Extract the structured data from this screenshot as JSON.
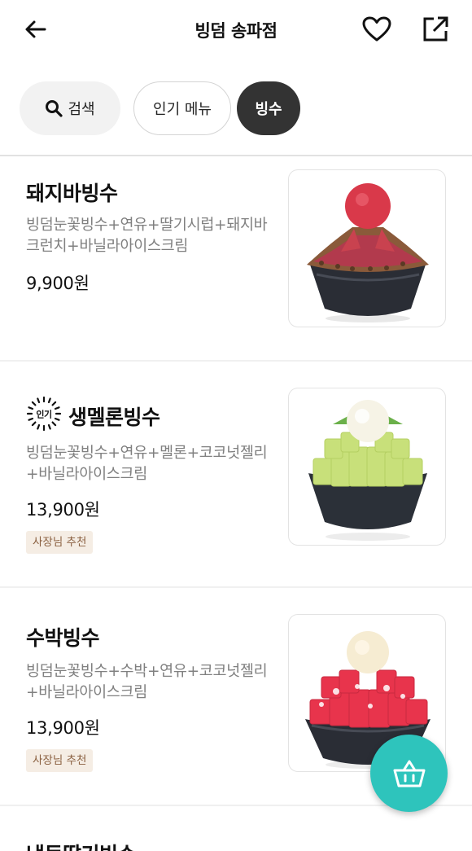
{
  "header": {
    "title": "빙덤 송파점",
    "icons": [
      "back-arrow-icon",
      "heart-icon",
      "share-icon"
    ]
  },
  "chips": {
    "search_label": "검색",
    "popular_label": "인기 메뉴",
    "bingsu_label": "빙수"
  },
  "menu_items": [
    {
      "name": "돼지바빙수",
      "description": "빙덤눈꽃빙수+연유+딸기시럽+돼지바크런치+바닐라아이스크림",
      "price": "9,900원"
    },
    {
      "popular_tag": "인기",
      "name": "생멜론빙수",
      "description": "빙덤눈꽃빙수+연유+멜론+코코넛젤리+바닐라아이스크림",
      "price": "13,900원",
      "badge": "사장님 추천"
    },
    {
      "name": "수박빙수",
      "description": "빙덤눈꽃빙수+수박+연유+코코넛젤리+바닐라아이스크림",
      "price": "13,900원",
      "badge": "사장님 추천"
    },
    {
      "name": "냉동딸기빙수"
    }
  ],
  "colors": {
    "accent": "#2ec4bc",
    "chip_selected": "#333333",
    "badge_bg": "#f5ede4",
    "badge_text": "#8a6040"
  }
}
